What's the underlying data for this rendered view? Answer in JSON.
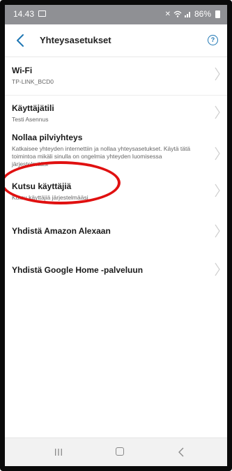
{
  "status_bar": {
    "time": "14.43",
    "battery": "86%",
    "icons": [
      "image-icon",
      "mute-icon",
      "wifi-icon",
      "signal-icon",
      "battery-icon"
    ]
  },
  "header": {
    "title": "Yhteysasetukset",
    "back_icon": "chevron-left-icon",
    "help_icon": "help-circle-icon",
    "help_glyph": "?"
  },
  "items": [
    {
      "title": "Wi-Fi",
      "subtitle": "TP-LINK_BCD0"
    },
    {
      "title": "Käyttäjätili",
      "subtitle": "Testi Asennus"
    },
    {
      "title": "Nollaa pilviyhteys",
      "subtitle": "Katkaisee yhteyden internettiin ja nollaa yhteysasetukset. Käytä tätä toimintoa mikäli sinulla on ongelmia yhteyden luomisessa järjestelmääsi"
    },
    {
      "title": "Kutsu käyttäjiä",
      "subtitle": "Kutsu käyttäjiä järjestelmääsi"
    },
    {
      "title": "Yhdistä Amazon Alexaan",
      "subtitle": ""
    },
    {
      "title": "Yhdistä Google Home -palveluun",
      "subtitle": ""
    }
  ],
  "colors": {
    "accent": "#1f77b4",
    "annotation": "#e01010",
    "status_bar": "#8f9094"
  },
  "nav_bar": {
    "icons": [
      "recents-icon",
      "home-icon",
      "back-icon"
    ]
  }
}
